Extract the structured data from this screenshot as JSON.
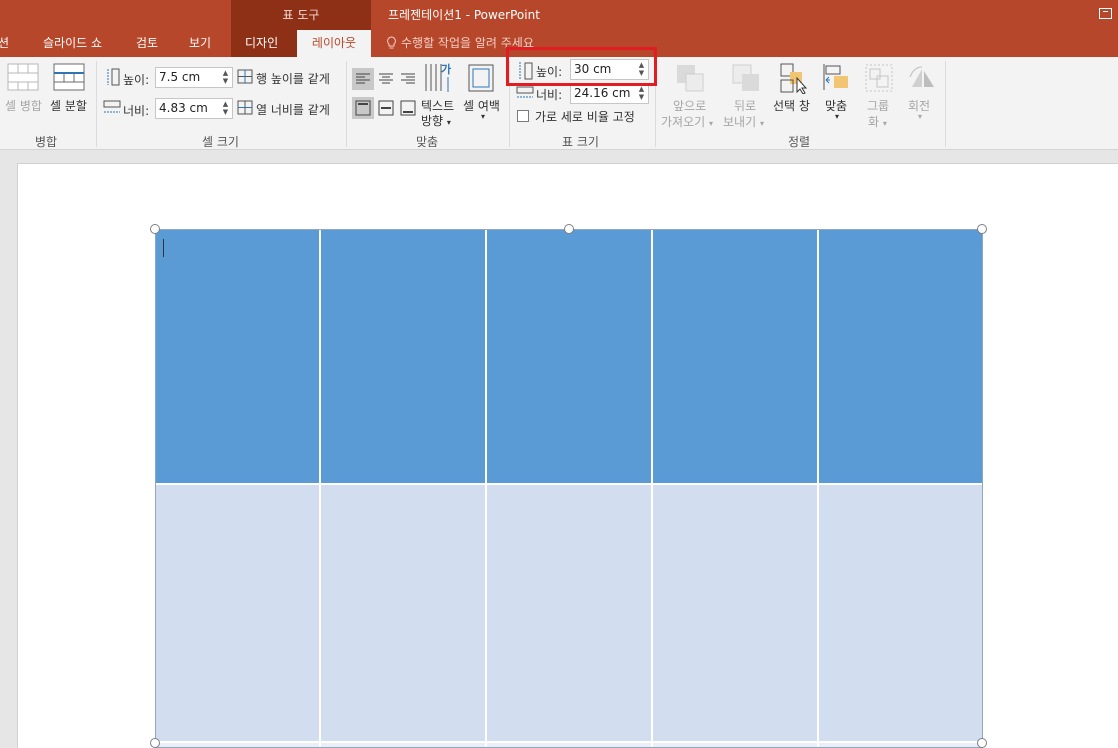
{
  "title_bar": {
    "context_tab_header": "표 도구",
    "document_title": "프레젠테이션1 - PowerPoint"
  },
  "tabs": [
    {
      "label": "션"
    },
    {
      "label": "슬라이드 쇼"
    },
    {
      "label": "검토"
    },
    {
      "label": "보기"
    },
    {
      "label": "디자인"
    },
    {
      "label": "레이아웃"
    }
  ],
  "active_tab": "레이아웃",
  "tell_me": "수행할 작업을 알려 주세요",
  "ribbon": {
    "merge": {
      "merge_cells": "셀 병합",
      "split_cells": "셀 분할",
      "group_label": "병합"
    },
    "cell_size": {
      "height_label": "높이:",
      "height_value": "7.5 cm",
      "width_label": "너비:",
      "width_value": "4.83 cm",
      "distribute_rows": "행 높이를 같게",
      "distribute_cols": "열 너비를 같게",
      "group_label": "셀 크기"
    },
    "alignment": {
      "text_direction_1": "텍스트",
      "text_direction_2": "방향",
      "cell_margins_1": "셀 여백",
      "group_label": "맞춤"
    },
    "table_size": {
      "height_label": "높이:",
      "height_value": "30 cm",
      "width_label": "너비:",
      "width_value": "24.16 cm",
      "lock_aspect": "가로 세로 비율 고정",
      "group_label": "표 크기"
    },
    "arrange": {
      "bring_forward_1": "앞으로",
      "bring_forward_2": "가져오기",
      "send_backward_1": "뒤로",
      "send_backward_2": "보내기",
      "selection_pane": "선택 창",
      "align": "맞춤",
      "group_1": "그룹",
      "group_2": "화",
      "rotate": "회전",
      "group_label": "정렬"
    }
  },
  "table": {
    "rows": 3,
    "cols": 5,
    "header_color": "#5b9bd5",
    "band_color": "#d2deef"
  },
  "colors": {
    "accent": "#b7472a",
    "highlight_box": "#e21c23"
  }
}
